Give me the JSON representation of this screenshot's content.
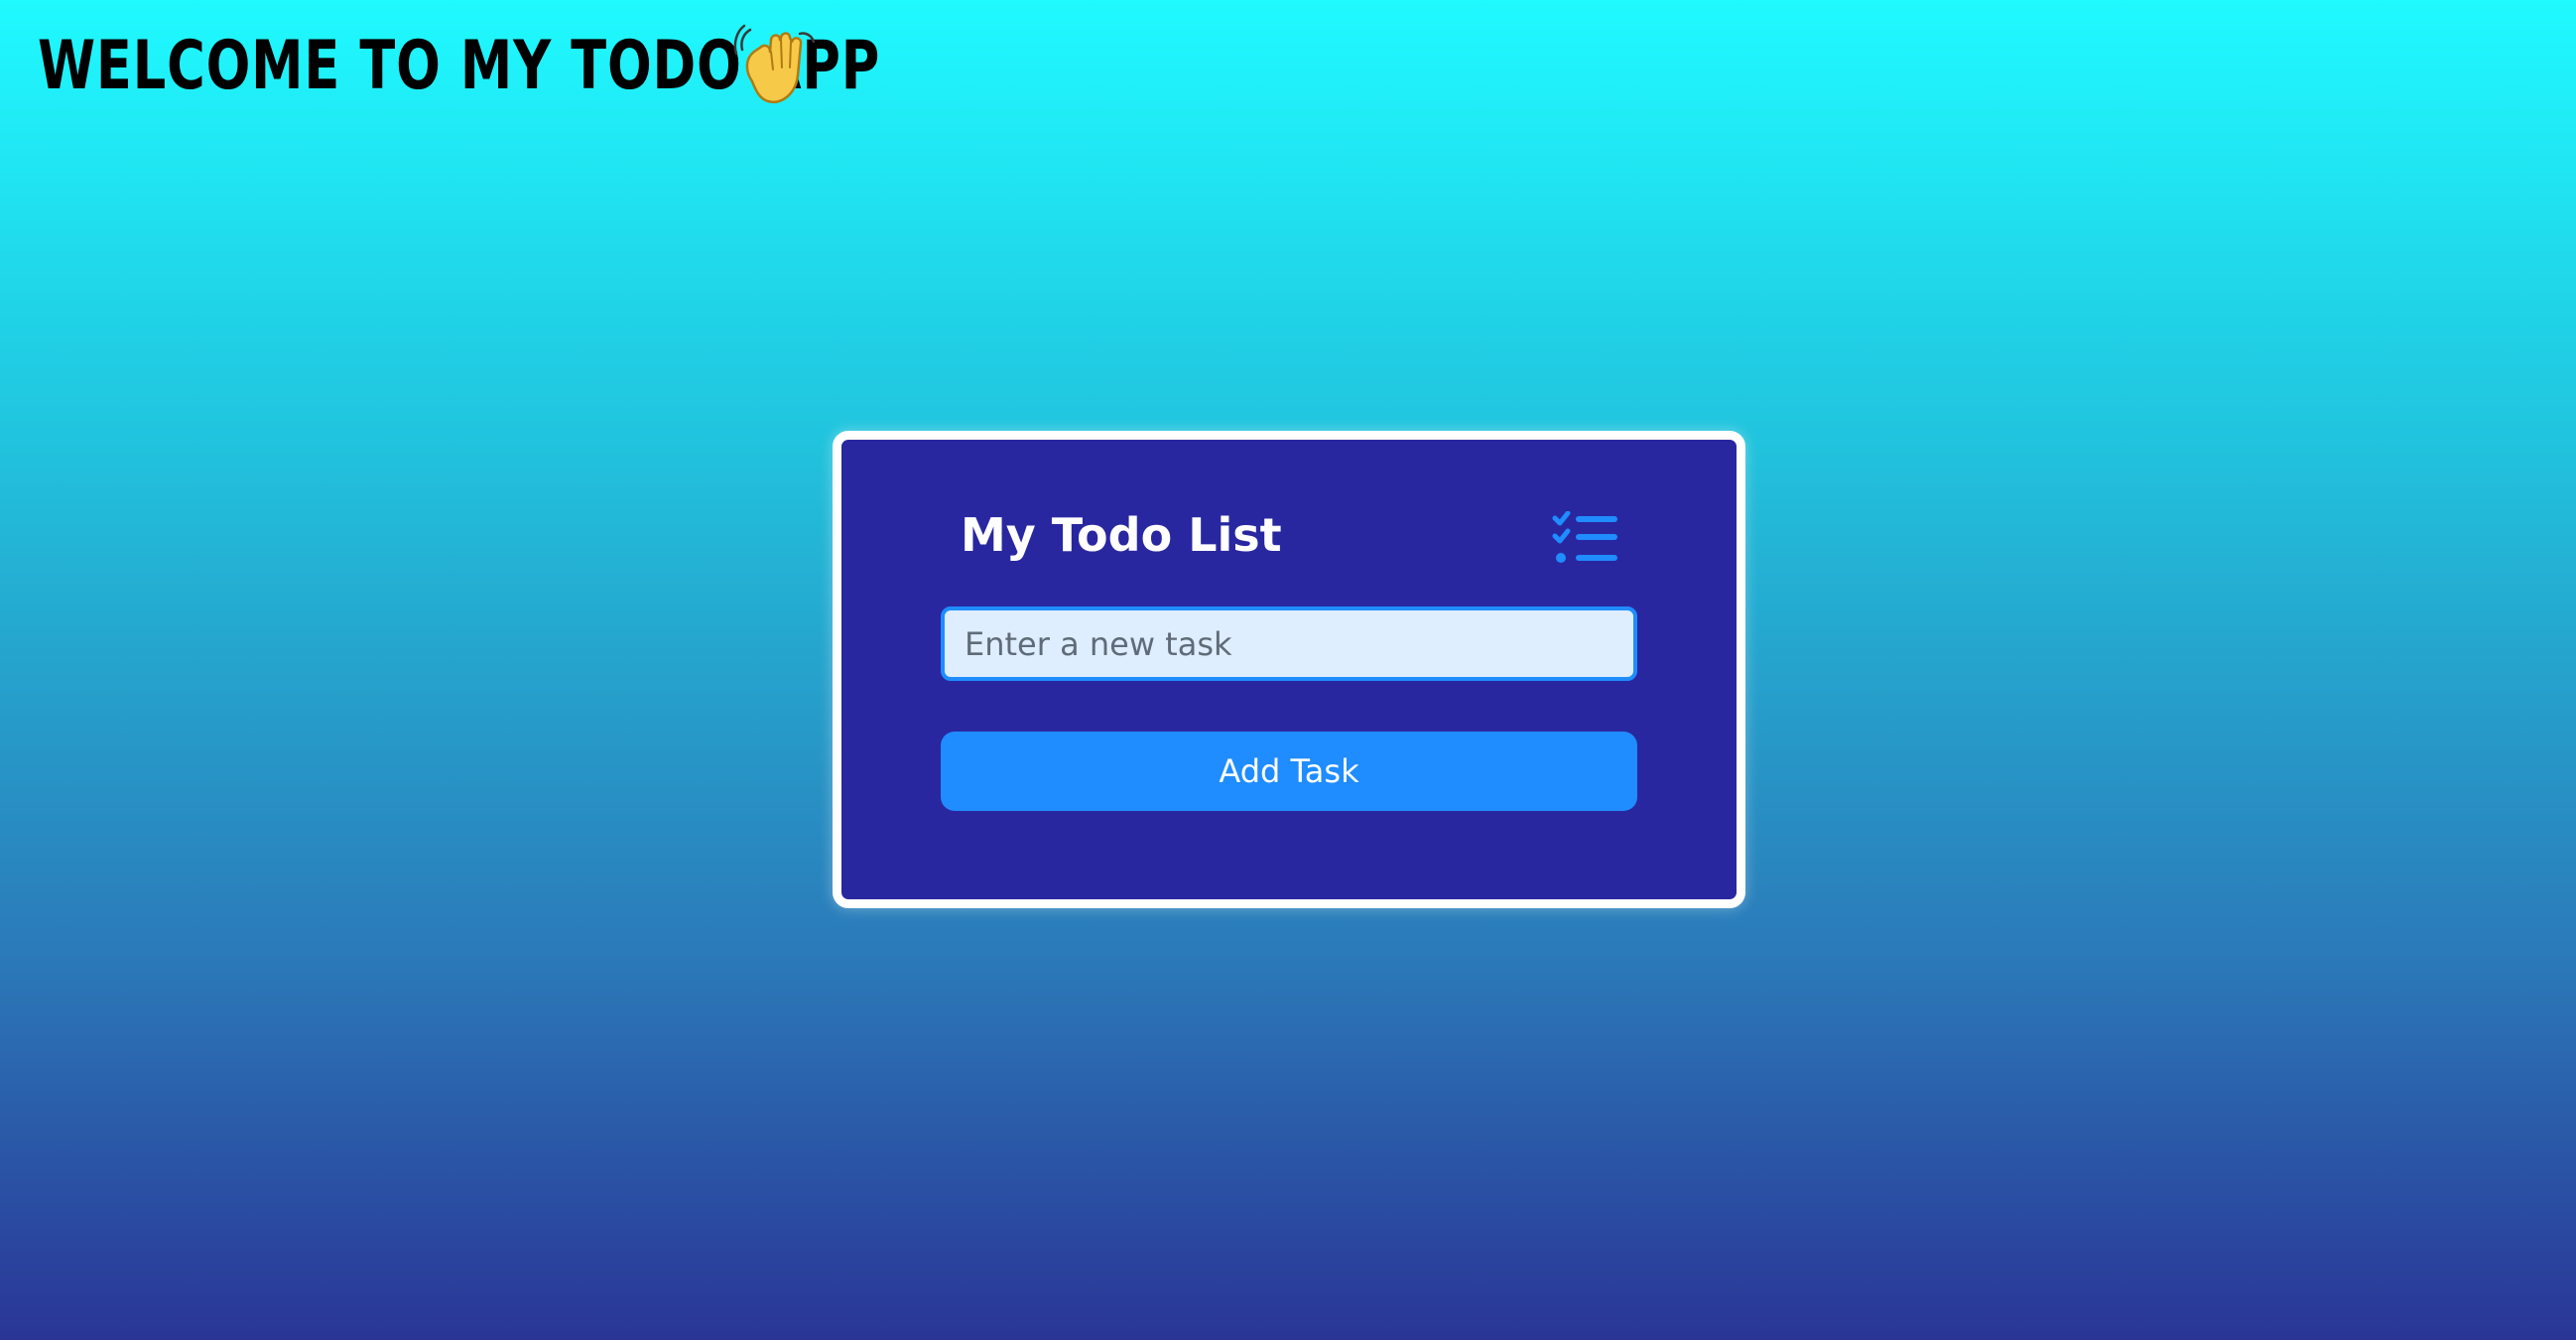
{
  "header": {
    "title": "WELCOME TO MY TODO APP",
    "icon": "waving-hand-icon"
  },
  "card": {
    "title": "My Todo List",
    "icon": "checklist-icon",
    "input": {
      "value": "",
      "placeholder": "Enter a new task"
    },
    "add_button_label": "Add Task"
  },
  "colors": {
    "background_top": "#1ffaff",
    "background_bottom": "#2a3596",
    "card_background": "#2927a0",
    "card_border": "#ffffff",
    "accent": "#1f8cff",
    "input_background": "#deeeff",
    "title_text": "#000000",
    "card_title_text": "#ffffff"
  }
}
